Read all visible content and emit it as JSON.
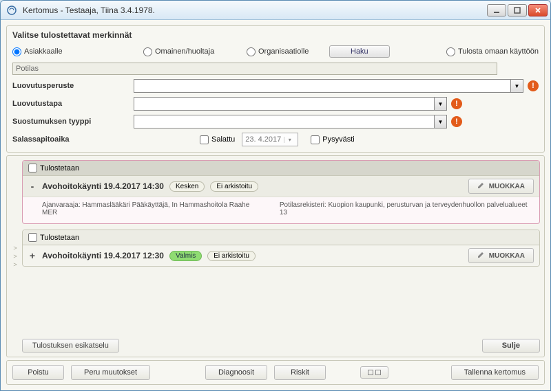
{
  "window": {
    "title": "Kertomus - Testaaja, Tiina 3.4.1978."
  },
  "topPanel": {
    "heading": "Valitse tulostettavat merkinnät",
    "radios": {
      "asiakkaalle": "Asiakkaalle",
      "omainen": "Omainen/huoltaja",
      "organisaatiolle": "Organisaatiolle",
      "omaan": "Tulosta omaan käyttöön"
    },
    "hakuLabel": "Haku",
    "potilasLabel": "Potilas",
    "rows": {
      "luovutusperuste": "Luovutusperuste",
      "luovutustapa": "Luovutustapa",
      "suostumuksenTyyppi": "Suostumuksen tyyppi",
      "salassapitoaika": "Salassapitoaika"
    },
    "salattuLabel": "Salattu",
    "dateValue": "23. 4.2017",
    "pysyvastiLabel": "Pysyvästi"
  },
  "entries": [
    {
      "tulostetaan": "Tulostetaan",
      "expand": "-",
      "title": "Avohoitokäynti 19.4.2017 14:30",
      "status": "Kesken",
      "archive": "Ei arkistoitu",
      "muokkaa": "MUOKKAA",
      "body1": "Ajanvaraaja: Hammaslääkäri Pääkäyttäjä, In Hammashoitola Raahe MER",
      "body2": "Potilasrekisteri: Kuopion kaupunki, perusturvan ja terveydenhuollon palvelualueet 13"
    },
    {
      "tulostetaan": "Tulostetaan",
      "expand": "+",
      "title": "Avohoitokäynti 19.4.2017 12:30",
      "status": "Valmis",
      "archive": "Ei arkistoitu",
      "muokkaa": "MUOKKAA"
    }
  ],
  "middleButtons": {
    "esikatselu": "Tulostuksen esikatselu",
    "sulje": "Sulje"
  },
  "bottomBar": {
    "poistu": "Poistu",
    "peru": "Peru muutokset",
    "diagnoosit": "Diagnoosit",
    "riskit": "Riskit",
    "tallenna": "Tallenna kertomus"
  }
}
